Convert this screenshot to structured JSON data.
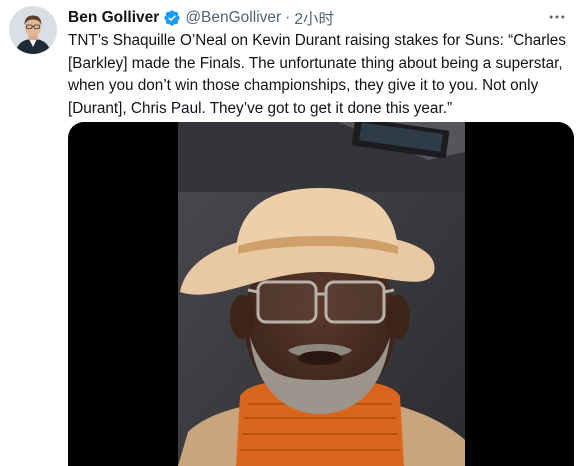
{
  "author": {
    "display_name": "Ben Golliver",
    "handle": "@BenGolliver",
    "separator": "·",
    "time_ago": "2小时",
    "verified_icon": "verified-badge-icon",
    "avatar_icon": "profile-photo"
  },
  "tweet": {
    "text": "TNT’s Shaquille O’Neal on Kevin Durant raising stakes for Suns: “Charles\n[Barkley] made the Finals. The unfortunate thing about being a superstar,\nwhen you don’t win those championships, they give it to you. Not only\n[Durant], Chris Paul. They’ve got to get it done this year.”"
  },
  "menu": {
    "icon": "more-options-icon"
  },
  "media": {
    "type": "video-still",
    "subject_icon": "man-in-hat-video-still"
  },
  "colors": {
    "text": "#0f1419",
    "secondary": "#536471",
    "verified": "#1d9bf0",
    "media_background": "#000000"
  }
}
